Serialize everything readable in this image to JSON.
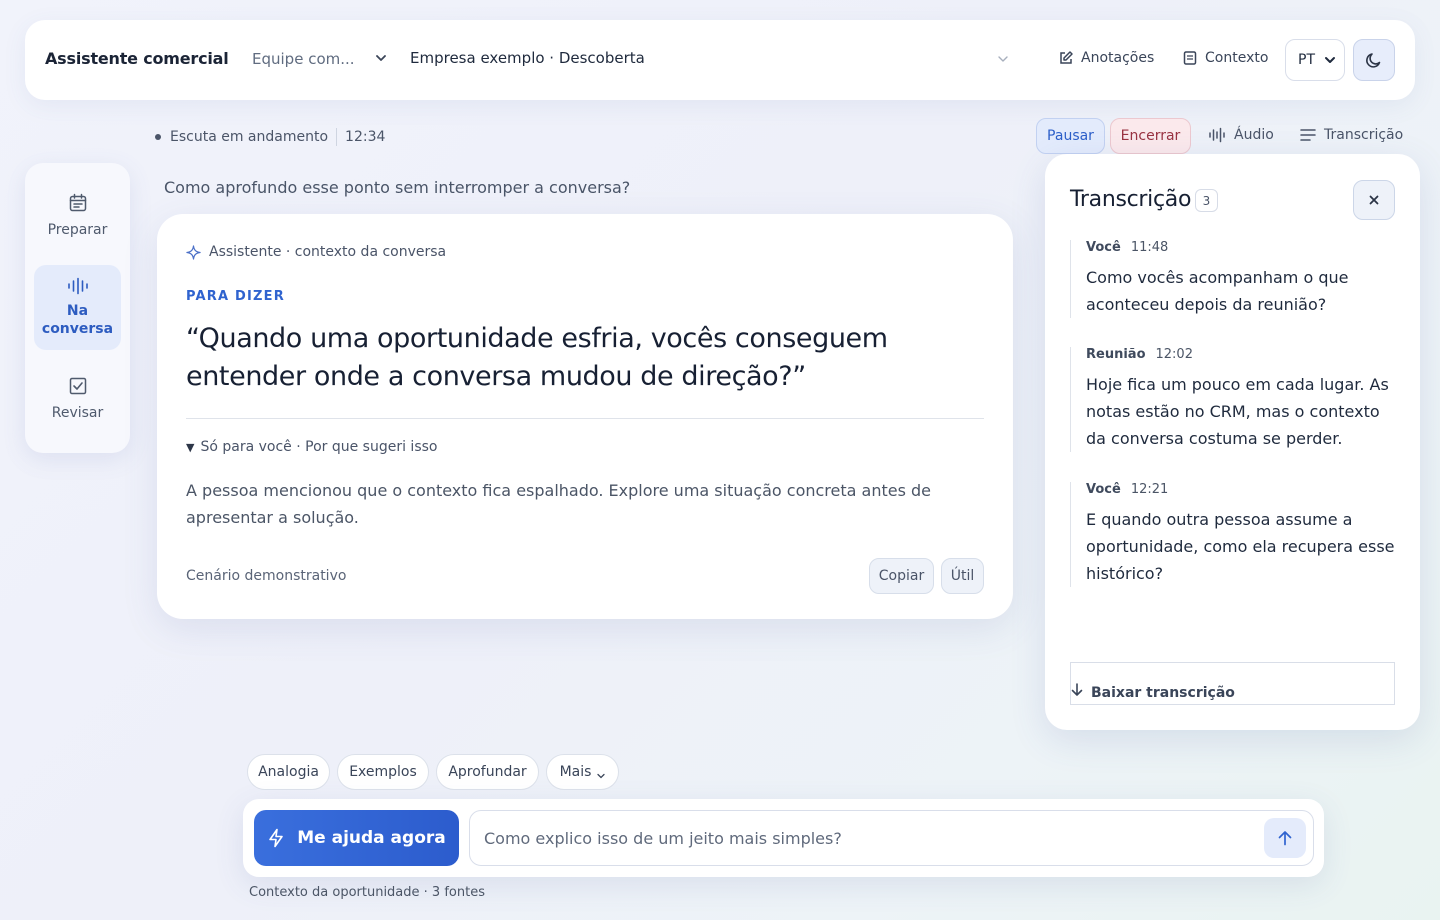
{
  "header": {
    "brand": "Assistente comercial",
    "team_select": "Equipe com...",
    "company": "Empresa exemplo · Descoberta",
    "notes_label": "Anotações",
    "context_label": "Contexto",
    "language": "PT"
  },
  "status": {
    "listening": "Escuta em andamento",
    "time": "12:34",
    "pause": "Pausar",
    "stop": "Encerrar",
    "audio": "Áudio",
    "transcript": "Transcrição"
  },
  "sidebar": {
    "items": [
      {
        "label": "Preparar",
        "icon": "calendar-icon"
      },
      {
        "label": "Na conversa",
        "icon": "waveform-icon",
        "active": true
      },
      {
        "label": "Revisar",
        "icon": "checkbox-icon"
      }
    ]
  },
  "main": {
    "question": "Como aprofundo esse ponto sem interromper a conversa?",
    "card": {
      "header": "Assistente · contexto da conversa",
      "tag": "PARA DIZER",
      "quote": "“Quando uma oportunidade esfria, vocês conseguem entender onde a conversa mudou de direção?”",
      "why_label": "Só para você · Por que sugeri isso",
      "explanation": "A pessoa mencionou que o contexto fica espalhado. Explore uma situação concreta antes de apresentar a solução.",
      "demo_label": "Cenário demonstrativo",
      "copy": "Copiar",
      "useful": "Útil"
    }
  },
  "transcript_panel": {
    "title": "Transcrição",
    "count": "3",
    "entries": [
      {
        "speaker": "Você",
        "time": "11:48",
        "text": "Como vocês acompanham o que aconteceu depois da reunião?"
      },
      {
        "speaker": "Reunião",
        "time": "12:02",
        "text": "Hoje fica um pouco em cada lugar. As notas estão no CRM, mas o contexto da conversa costuma se perder."
      },
      {
        "speaker": "Você",
        "time": "12:21",
        "text": "E quando outra pessoa assume a oportunidade, como ela recupera esse histórico?"
      }
    ],
    "download": "Baixar transcrição"
  },
  "chips": [
    "Analogia",
    "Exemplos",
    "Aprofundar",
    "Mais"
  ],
  "composer": {
    "help_button": "Me ajuda agora",
    "placeholder": "Como explico isso de um jeito mais simples?",
    "footnote": "Contexto da oportunidade · 3 fontes"
  },
  "colors": {
    "accent": "#2f63cf",
    "danger": "#9a3342",
    "background": "#eef0f9"
  }
}
